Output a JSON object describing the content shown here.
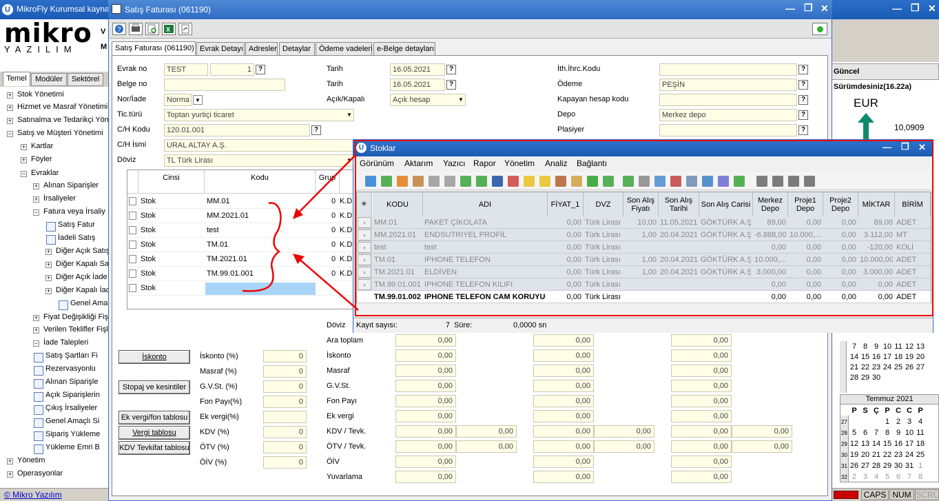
{
  "main_window": {
    "title": "MikroFly Kurumsal kaynak"
  },
  "logo": {
    "brand": "mikro",
    "sub": "YAZILIM",
    "v": "V",
    "m": "M"
  },
  "sidebar": {
    "tabs": [
      "Temel",
      "Modüler",
      "Sektörel"
    ],
    "items": [
      "Stok Yönetimi",
      "Hizmet ve Masraf Yönetimi",
      "Satınalma ve Tedarikçi Yöne",
      "Satış ve Müşteri Yönetimi",
      "Kartlar",
      "Föyler",
      "Evraklar",
      "Alınan Siparişler",
      "İrsaliyeler",
      "Fatura veya İrsaliy",
      "Satış Fatur",
      "İadeli Satış",
      "Diğer Açık Satış",
      "Diğer Kapalı Sa",
      "Diğer Açık İade",
      "Diğer Kapalı İad",
      "Genel Amaç",
      "Fiyat Değişikliği Fişl",
      "Verilen Teklifler Fişl",
      "İade Talepleri",
      "Satış Şartları Fi",
      "Rezervasyonlu",
      "Alınan Siparişle",
      "Açık Siparişlerin",
      "Çıkış İrsaliyeler",
      "Genel Amaçlı Si",
      "Sipariş Yükleme",
      "Yükleme Emri B",
      "Yönetim",
      "Operasyonlar"
    ],
    "footer_link": "© Mikro Yazılım"
  },
  "invoice": {
    "title": "Satış Faturası (061190)",
    "tabs": [
      "Satış Faturası (061190)",
      "Evrak Detayı",
      "Adresler",
      "Detaylar",
      "Ödeme vadeleri",
      "e-Belge detayları"
    ],
    "labels": {
      "evrak_no": "Evrak no",
      "belge_no": "Belge no",
      "nor_iade": "Nor/İade",
      "tic_turu": "Tic.türü",
      "ch_kodu": "C/H Kodu",
      "ch_ismi": "C/H İsmi",
      "doviz": "Döviz",
      "tarih1": "Tarih",
      "tarih2": "Tarih",
      "acik_kapali": "Açık/Kapalı",
      "ith_ihrc": "İth.İhrc.Kodu",
      "odeme": "Ödeme",
      "kapayan": "Kapayan hesap kodu",
      "depo": "Depo",
      "plasiyer": "Plasiyer"
    },
    "values": {
      "evrak_seri": "TEST",
      "evrak_sira": "1",
      "belge_no": "",
      "nor_iade": "Norma",
      "tic_turu": "Toptan yurtiçi ticaret",
      "ch_kodu": "120.01.001",
      "ch_ismi": "URAL ALTAY A.Ş.",
      "doviz": "TL  Türk Lirası",
      "tarih1": "16.05.2021",
      "tarih2": "16.05.2021",
      "acik_kapali": "Açık hesap",
      "ith_ihrc": "",
      "odeme": "PEŞİN",
      "kapayan": "",
      "depo": "Merkez depo",
      "plasiyer": ""
    },
    "grid": {
      "headers": [
        "Cinsi",
        "Kodu",
        "Grup"
      ],
      "rows": [
        {
          "cinsi": "Stok",
          "kodu": "MM.01",
          "num": "0",
          "grup": "K.D"
        },
        {
          "cinsi": "Stok",
          "kodu": "MM.2021.01",
          "num": "0",
          "grup": "K.D"
        },
        {
          "cinsi": "Stok",
          "kodu": "test",
          "num": "0",
          "grup": "K.D"
        },
        {
          "cinsi": "Stok",
          "kodu": "TM.01",
          "num": "0",
          "grup": "K.D"
        },
        {
          "cinsi": "Stok",
          "kodu": "TM.2021.01",
          "num": "0",
          "grup": "K.D"
        },
        {
          "cinsi": "Stok",
          "kodu": "TM.99.01.001",
          "num": "0",
          "grup": "K.D"
        },
        {
          "cinsi": "Stok",
          "kodu": "",
          "num": "",
          "grup": ""
        }
      ]
    },
    "buttons": [
      "İskonto",
      "Stopaj ve kesintiler",
      "Ek vergi/fon tablosu",
      "Vergi tablosu",
      "KDV Tevkifat tablosu"
    ],
    "pct_labels": [
      "İskonto (%)",
      "Masraf (%)",
      "G.V.St. (%)",
      "Fon Payı(%)",
      "Ek vergi(%)",
      "KDV     (%)",
      "ÖTV     (%)",
      "ÖİV     (%)"
    ],
    "pct_values": [
      "0",
      "0",
      "0",
      "0",
      "",
      "0",
      "0",
      "0"
    ],
    "totals_labels": [
      "Döviz",
      "Ara toplam",
      "İskonto",
      "Masraf",
      "G.V.St.",
      "Fon Payı",
      "Ek vergi",
      "KDV / Tevk.",
      "ÖTV / Tevk.",
      "ÖİV",
      "Yuvarlama"
    ],
    "zero": "0,00"
  },
  "stoklar": {
    "title": "Stoklar",
    "menu": [
      "Görünüm",
      "Aktarım",
      "Yazıcı",
      "Rapor",
      "Yönetim",
      "Analiz",
      "Bağlantı"
    ],
    "headers": [
      "KODU",
      "ADI",
      "FİYAT_1",
      "DVZ",
      "Son Alış Fiyatı",
      "Son Alış Tarihi",
      "Son Alış Carisi",
      "Merkez Depo",
      "Proje1 Depo",
      "Proje2 Depo",
      "MİKTAR",
      "BİRİM"
    ],
    "rows": [
      [
        "MM.01",
        "PAKET ÇİKOLATA",
        "0,00",
        "Türk Lirası",
        "10,00",
        "11.05.2021",
        "GÖKTÜRK A.Ş.",
        "89,00",
        "0,00",
        "0,00",
        "89,00",
        "ADET"
      ],
      [
        "MM.2021.01",
        "ENDSUTRIYEL PROFİL",
        "0,00",
        "Türk Lirası",
        "1,00",
        "20.04.2021",
        "GÖKTÜRK A.Ş.",
        "-6.888,00",
        "10.000,...",
        "0,00",
        "3.112,00",
        "MT"
      ],
      [
        "test",
        "test",
        "0,00",
        "Türk Lirası",
        "",
        "",
        "",
        "0,00",
        "0,00",
        "0,00",
        "-120,00",
        "KOLİ"
      ],
      [
        "TM.01",
        "IPHONE TELEFON",
        "0,00",
        "Türk Lirası",
        "1,00",
        "20.04.2021",
        "GÖKTÜRK A.Ş.",
        "10.000,...",
        "0,00",
        "0,00",
        "10.000,00",
        "ADET"
      ],
      [
        "TM.2021.01",
        "ELDİVEN",
        "0,00",
        "Türk Lirası",
        "1,00",
        "20.04.2021",
        "GÖKTÜRK A.Ş.",
        "3.000,00",
        "0,00",
        "0,00",
        "3.000,00",
        "ADET"
      ],
      [
        "TM.99.01.001",
        "IPHONE TELEFON KILIFI",
        "0,00",
        "Türk Lirası",
        "",
        "",
        "",
        "0,00",
        "0,00",
        "0,00",
        "0,00",
        "ADET"
      ],
      [
        "TM.99.01.002",
        "IPHONE TELEFON CAM KORUYUCU",
        "0,00",
        "Türk Lirası",
        "",
        "",
        "",
        "0,00",
        "0,00",
        "0,00",
        "0,00",
        "ADET"
      ]
    ],
    "status": {
      "kayit_label": "Kayıt sayısı:",
      "kayit_value": "7",
      "sure_label": "Süre:",
      "sure_value": "0,0000 sn"
    }
  },
  "right_panel": {
    "version": "Güncel Sürümdesiniz(16.22a)",
    "currency": "EUR",
    "rate": "10,0909",
    "cal1_rows": [
      [
        "7",
        "8",
        "9",
        "10",
        "11",
        "12",
        "13"
      ],
      [
        "14",
        "15",
        "16",
        "17",
        "18",
        "19",
        "20"
      ],
      [
        "21",
        "22",
        "23",
        "24",
        "25",
        "26",
        "27"
      ],
      [
        "28",
        "29",
        "30",
        "",
        "",
        "",
        ""
      ]
    ],
    "cal2_title": "Temmuz 2021",
    "cal2_days": [
      "P",
      "S",
      "Ç",
      "P",
      "C",
      "C",
      "P"
    ],
    "cal2_weeks": [
      "27",
      "28",
      "29",
      "30",
      "31",
      "32"
    ],
    "cal2_rows": [
      [
        "",
        "",
        "",
        "1",
        "2",
        "3",
        "4"
      ],
      [
        "5",
        "6",
        "7",
        "8",
        "9",
        "10",
        "11"
      ],
      [
        "12",
        "13",
        "14",
        "15",
        "16",
        "17",
        "18"
      ],
      [
        "19",
        "20",
        "21",
        "22",
        "23",
        "24",
        "25"
      ],
      [
        "26",
        "27",
        "28",
        "29",
        "30",
        "31",
        "1"
      ],
      [
        "2",
        "3",
        "4",
        "5",
        "6",
        "7",
        "8"
      ]
    ]
  },
  "statusbar": {
    "caps": "CAPS",
    "num": "NUM",
    "scrl": "SCRL"
  }
}
